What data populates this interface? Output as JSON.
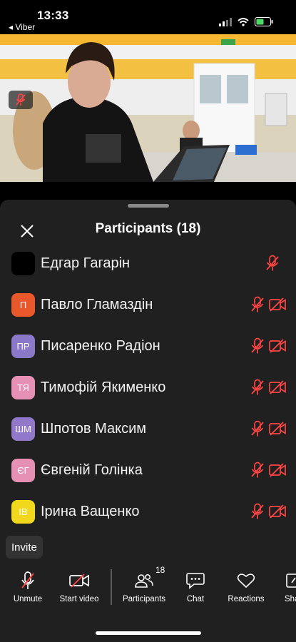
{
  "status": {
    "time": "13:33",
    "back_app": "◂ Viber"
  },
  "panel": {
    "title": "Participants (18)"
  },
  "participants": [
    {
      "name": "Едгар Гагарін",
      "initials": "",
      "color": "#000000",
      "video": false
    },
    {
      "name": "Павло Гламаздін",
      "initials": "П",
      "color": "#e8582b",
      "video": true
    },
    {
      "name": "Писаренко Радіон",
      "initials": "ПР",
      "color": "#8a78c9",
      "video": true
    },
    {
      "name": "Тимофій Якименко",
      "initials": "ТЯ",
      "color": "#e690b5",
      "video": true
    },
    {
      "name": "Шпотов Максим",
      "initials": "ШМ",
      "color": "#9278c9",
      "video": true
    },
    {
      "name": "Євгеній Голінка",
      "initials": "ЄГ",
      "color": "#e690b5",
      "video": true
    },
    {
      "name": "Ірина Ващенко",
      "initials": "ІВ",
      "color": "#f2d81c",
      "video": true
    }
  ],
  "invite_label": "Invite",
  "toolbar": {
    "unmute": "Unmute",
    "start_video": "Start video",
    "participants": "Participants",
    "participants_count": "18",
    "chat": "Chat",
    "reactions": "Reactions",
    "share": "Share"
  },
  "colors": {
    "muted_red": "#ff4545",
    "panel_bg": "#202020"
  }
}
